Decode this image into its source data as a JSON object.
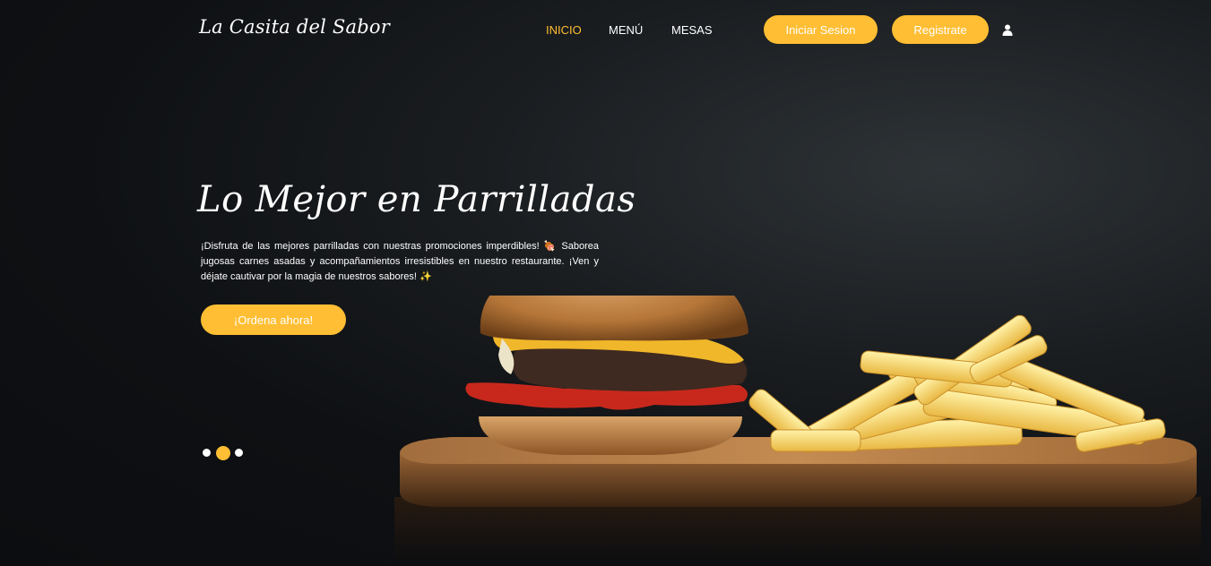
{
  "brand": {
    "name": "La Casita del Sabor"
  },
  "nav": {
    "items": [
      {
        "label": "INICIO",
        "active": true
      },
      {
        "label": "MENÚ",
        "active": false
      },
      {
        "label": "MESAS",
        "active": false
      }
    ],
    "login_label": "Iniciar Sesion",
    "register_label": "Registrate",
    "user_icon": "user-icon"
  },
  "hero": {
    "title": "Lo Mejor en Parrilladas",
    "description_main": "¡Disfruta de las mejores parrilladas con nuestras promociones imperdibles! ",
    "description_emoji_1": "🍖",
    "description_rest": " Saborea jugosas carnes asadas y acompañamientos irresistibles en nuestro restaurante. ¡Ven y déjate cautivar por la magia de nuestros sabores! ",
    "description_emoji_2": "✨",
    "cta_label": "¡Ordena ahora!"
  },
  "carousel": {
    "slide_count": 3,
    "active_slide": 2
  },
  "colors": {
    "accent": "#ffbe33",
    "background": "#0d0f12",
    "text": "#ffffff"
  }
}
